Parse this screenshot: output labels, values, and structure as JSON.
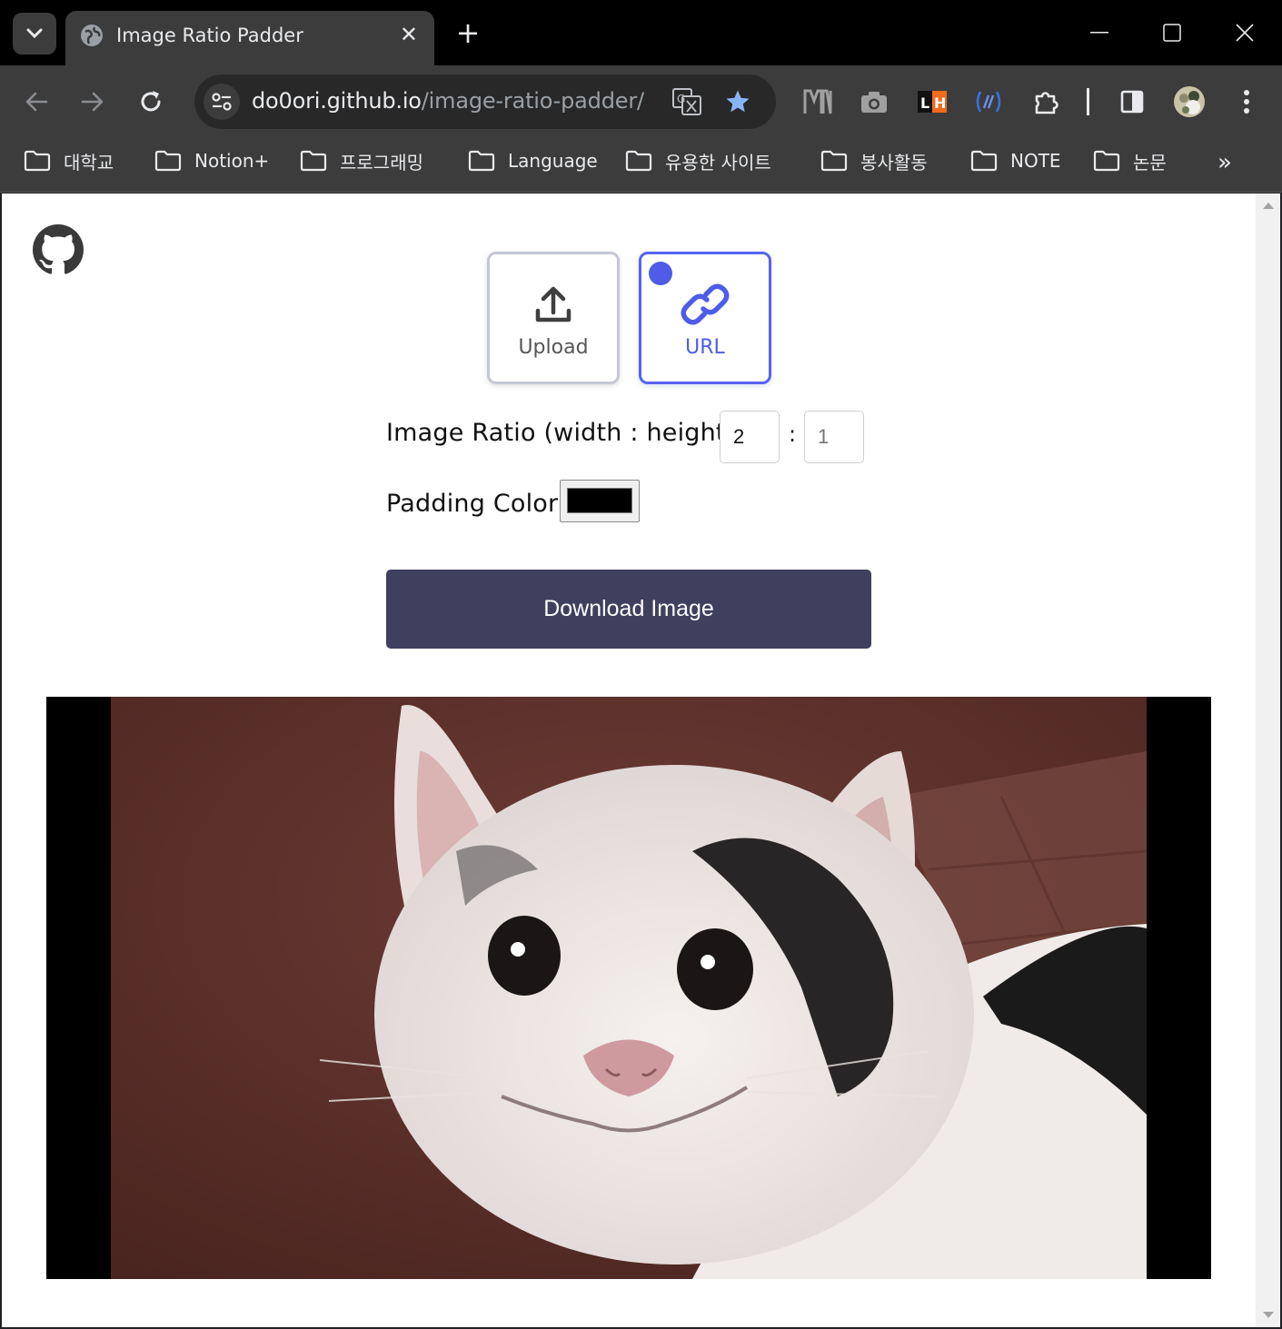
{
  "browser": {
    "tab_title": "Image Ratio Padder",
    "new_tab_symbol": "+",
    "close_tab_symbol": "✕",
    "url_host": "do0ori.github.io",
    "url_path": "/image-ratio-padder/",
    "bookmarks": [
      {
        "label": "대학교"
      },
      {
        "label": "Notion+"
      },
      {
        "label": "프로그래밍"
      },
      {
        "label": "Language"
      },
      {
        "label": "유용한 사이트"
      },
      {
        "label": "봉사활동"
      },
      {
        "label": "NOTE"
      },
      {
        "label": "논문"
      }
    ],
    "bookmarks_overflow_symbol": "»"
  },
  "page": {
    "source_buttons": {
      "upload_label": "Upload",
      "url_label": "URL",
      "selected": "URL"
    },
    "ratio": {
      "label": "Image Ratio (width : height)",
      "separator": ":",
      "width_value": "2",
      "height_placeholder": "1"
    },
    "padding": {
      "label": "Padding Color",
      "color": "#000000"
    },
    "download_label": "Download Image"
  },
  "colors": {
    "accent": "#4e5ce8",
    "button_bg": "#3f405e",
    "bookmark_star": "#8ab4f8"
  }
}
